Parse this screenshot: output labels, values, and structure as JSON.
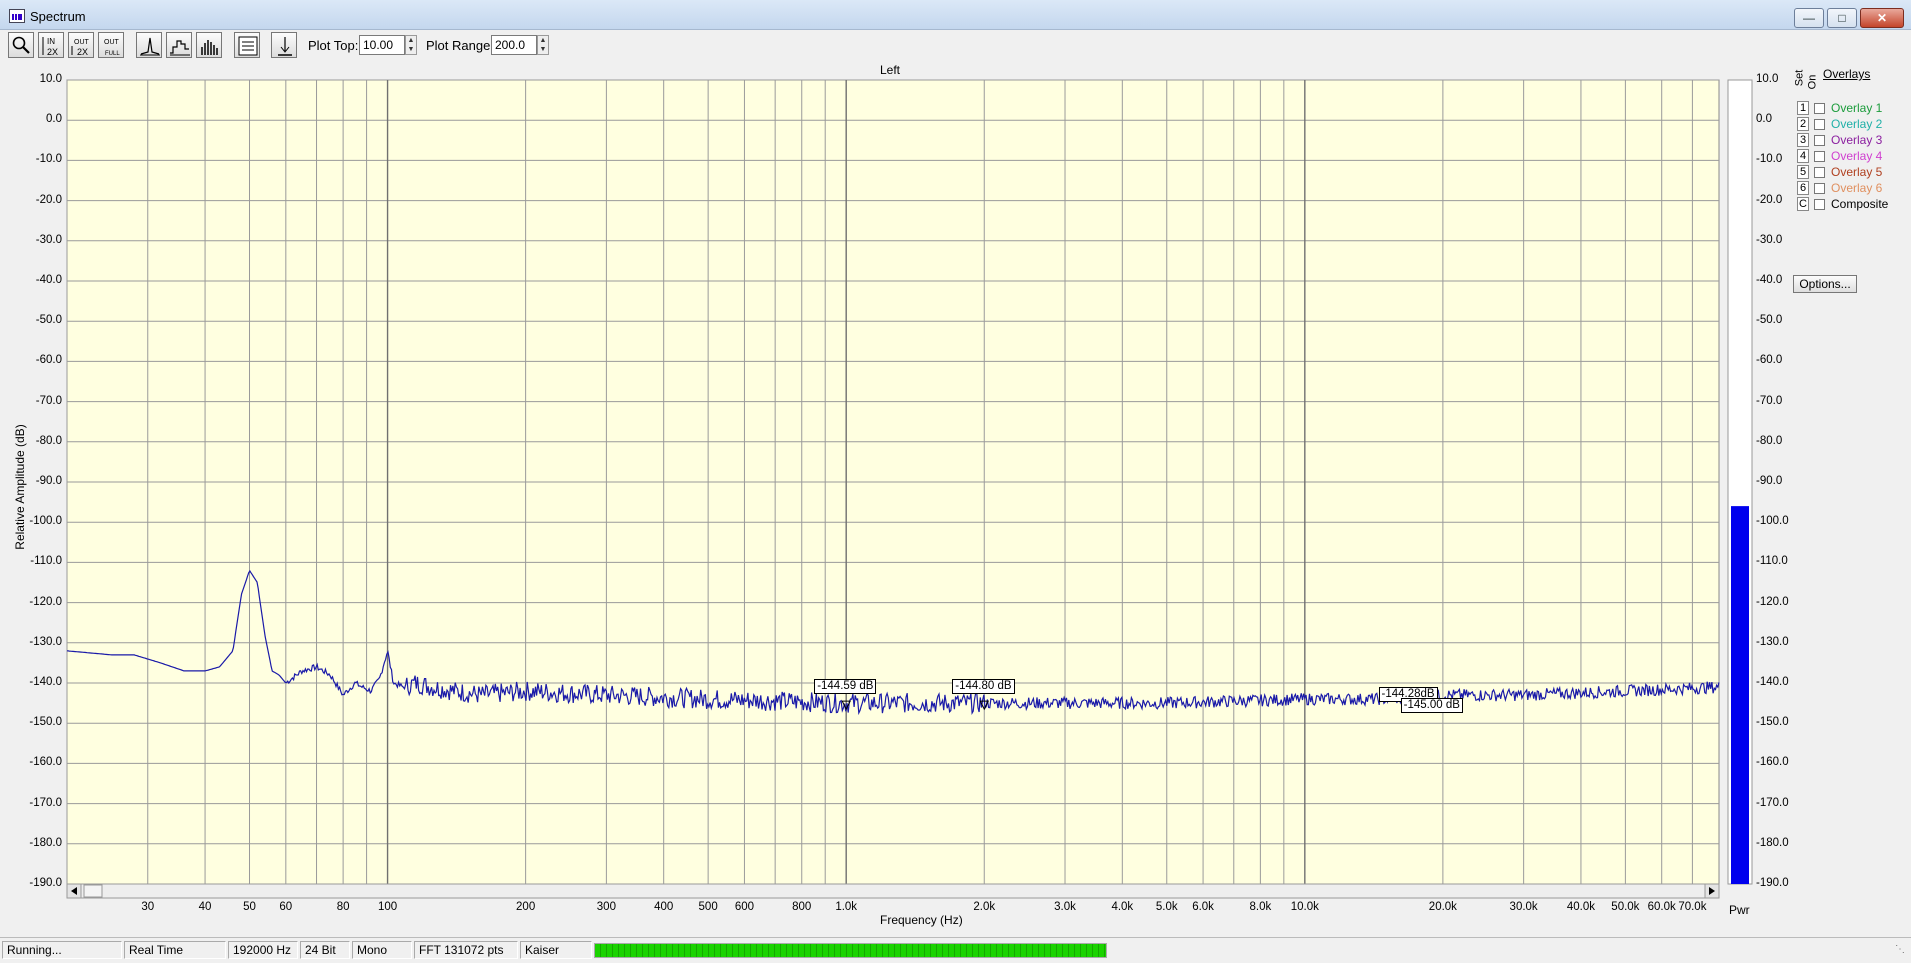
{
  "window": {
    "title": "Spectrum",
    "icon": "spectrum-app-icon",
    "controls": [
      "minimize",
      "maximize",
      "close"
    ]
  },
  "toolbar": {
    "buttons": [
      {
        "name": "zoom",
        "icon": "magnifier-icon"
      },
      {
        "name": "zoom-in-2x",
        "icon": "zoom-in-2x-icon",
        "top": "IN",
        "bottom": "2X"
      },
      {
        "name": "zoom-out-2x",
        "icon": "zoom-out-2x-icon",
        "top": "OUT",
        "bottom": "2X"
      },
      {
        "name": "zoom-out-full",
        "icon": "zoom-out-full-icon",
        "top": "OUT",
        "bottom": "FULL"
      },
      {
        "name": "peak-mode",
        "icon": "peak-icon"
      },
      {
        "name": "line-mode",
        "icon": "step-icon"
      },
      {
        "name": "bar-mode",
        "icon": "bars-icon"
      },
      {
        "name": "info",
        "icon": "list-icon"
      },
      {
        "name": "marker",
        "icon": "marker-icon"
      }
    ],
    "plot_top_label": "Plot Top:",
    "plot_top_value": "10.00",
    "plot_range_label": "Plot Range:",
    "plot_range_value": "200.0"
  },
  "panel": {
    "channel_title": "Left",
    "y_axis_title": "Relative Amplitude (dB)",
    "x_axis_title": "Frequency (Hz)",
    "pwr_label": "Pwr"
  },
  "chart_data": {
    "type": "line",
    "title": "Left",
    "xlabel": "Frequency (Hz)",
    "ylabel": "Relative Amplitude (dB)",
    "x_scale": "log",
    "xlim": [
      20,
      80000
    ],
    "ylim": [
      -190,
      10
    ],
    "grid": true,
    "background": "#ffffe0",
    "line_color": "#1a1aa8",
    "y_ticks": [
      "10.0",
      "0.0",
      "-10.0",
      "-20.0",
      "-30.0",
      "-40.0",
      "-50.0",
      "-60.0",
      "-70.0",
      "-80.0",
      "-90.0",
      "-100.0",
      "-110.0",
      "-120.0",
      "-130.0",
      "-140.0",
      "-150.0",
      "-160.0",
      "-170.0",
      "-180.0",
      "-190.0"
    ],
    "x_ticks": [
      {
        "value": 30,
        "label": "30"
      },
      {
        "value": 40,
        "label": "40"
      },
      {
        "value": 50,
        "label": "50"
      },
      {
        "value": 60,
        "label": "60"
      },
      {
        "value": 80,
        "label": "80"
      },
      {
        "value": 100,
        "label": "100"
      },
      {
        "value": 200,
        "label": "200"
      },
      {
        "value": 300,
        "label": "300"
      },
      {
        "value": 400,
        "label": "400"
      },
      {
        "value": 500,
        "label": "500"
      },
      {
        "value": 600,
        "label": "600"
      },
      {
        "value": 800,
        "label": "800"
      },
      {
        "value": 1000,
        "label": "1.0k"
      },
      {
        "value": 2000,
        "label": "2.0k"
      },
      {
        "value": 3000,
        "label": "3.0k"
      },
      {
        "value": 4000,
        "label": "4.0k"
      },
      {
        "value": 5000,
        "label": "5.0k"
      },
      {
        "value": 6000,
        "label": "6.0k"
      },
      {
        "value": 8000,
        "label": "8.0k"
      },
      {
        "value": 10000,
        "label": "10.0k"
      },
      {
        "value": 20000,
        "label": "20.0k"
      },
      {
        "value": 30000,
        "label": "30.0k"
      },
      {
        "value": 40000,
        "label": "40.0k"
      },
      {
        "value": 50000,
        "label": "50.0k"
      },
      {
        "value": 60000,
        "label": "60.0k"
      },
      {
        "value": 70000,
        "label": "70.0k"
      }
    ],
    "series": [
      {
        "x": [
          20,
          25,
          28,
          32,
          36,
          40,
          43,
          46,
          48,
          50,
          52,
          54,
          56,
          58,
          60,
          65,
          70,
          75,
          80,
          85,
          88,
          92,
          96,
          100,
          103,
          108,
          115,
          125,
          140,
          160,
          200,
          300,
          500,
          1000,
          2000,
          5000,
          10000,
          15000,
          20000,
          30000,
          50000,
          80000
        ],
        "y": [
          -132,
          -133,
          -133,
          -135,
          -137,
          -137,
          -136,
          -132,
          -118,
          -112,
          -115,
          -128,
          -137,
          -138,
          -140,
          -137,
          -136,
          -138,
          -143,
          -140,
          -141,
          -142,
          -139,
          -132,
          -140,
          -141,
          -140,
          -141,
          -142,
          -143,
          -142,
          -143,
          -144,
          -145,
          -145,
          -145,
          -144,
          -144,
          -143,
          -143,
          -142,
          -141
        ]
      }
    ],
    "markers": [
      {
        "x": 1000,
        "label": "-144.59 dB"
      },
      {
        "x": 2000,
        "label": "-144.80 dB"
      },
      {
        "x": 17000,
        "label": "-144.28dB"
      },
      {
        "x": 19000,
        "label": "-145.00 dB"
      }
    ],
    "power_meter": {
      "level_db": -96,
      "ylim": [
        -190,
        10
      ],
      "color": "#0000ee",
      "ticks": [
        "10.0",
        "0.0",
        "-10.0",
        "-20.0",
        "-30.0",
        "-40.0",
        "-50.0",
        "-60.0",
        "-70.0",
        "-80.0",
        "-90.0",
        "-100.0",
        "-110.0",
        "-120.0",
        "-130.0",
        "-140.0",
        "-150.0",
        "-160.0",
        "-170.0",
        "-180.0",
        "-190.0"
      ]
    }
  },
  "overlays": {
    "title": "Overlays",
    "col_set": "Set",
    "col_on": "On",
    "items": [
      {
        "key": "1",
        "label": "Overlay 1",
        "color": "#1c9c3c"
      },
      {
        "key": "2",
        "label": "Overlay 2",
        "color": "#20b0a8"
      },
      {
        "key": "3",
        "label": "Overlay 3",
        "color": "#8c20a0"
      },
      {
        "key": "4",
        "label": "Overlay 4",
        "color": "#d040d0"
      },
      {
        "key": "5",
        "label": "Overlay 5",
        "color": "#b04020"
      },
      {
        "key": "6",
        "label": "Overlay 6",
        "color": "#e09060"
      },
      {
        "key": "C",
        "label": "Composite",
        "color": "#000000"
      }
    ],
    "options_label": "Options..."
  },
  "status": {
    "state": "Running...",
    "mode": "Real Time",
    "sample_rate": "192000 Hz",
    "bit_depth": "24 Bit",
    "channels": "Mono",
    "fft": "FFT 131072 pts",
    "window": "Kaiser",
    "level_fraction": 0.6
  }
}
